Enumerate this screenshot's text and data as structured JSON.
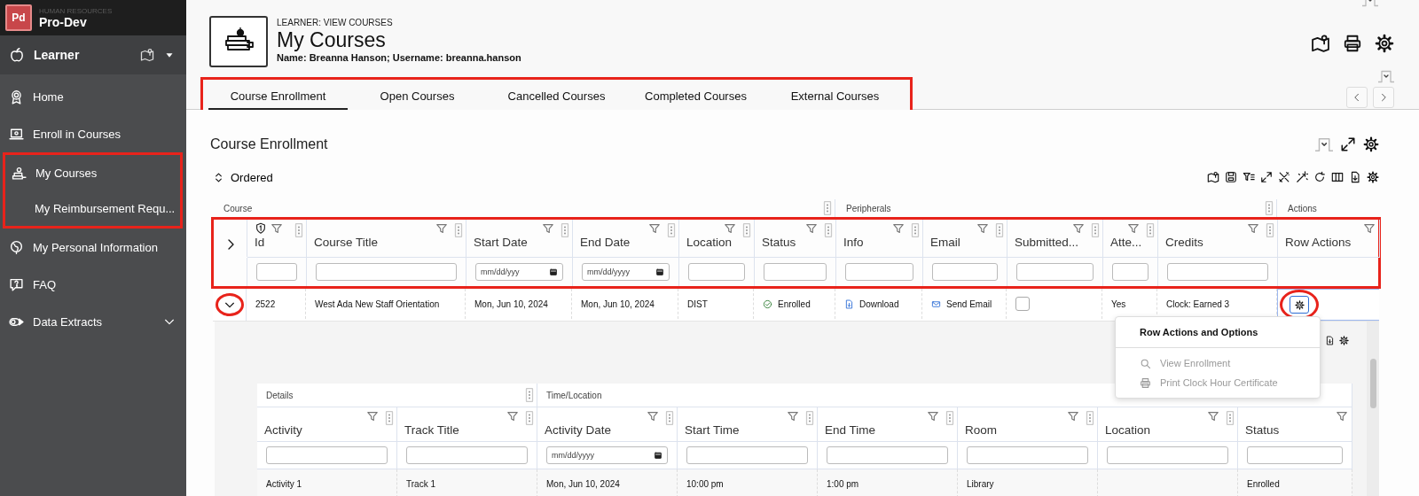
{
  "app": {
    "logo": "Pd",
    "org": "HUMAN RESOURCES",
    "name": "Pro-Dev"
  },
  "role": {
    "label": "Learner"
  },
  "nav": [
    {
      "label": "Home",
      "highlighted": false
    },
    {
      "label": "Enroll in Courses",
      "highlighted": false
    },
    {
      "label": "My Courses",
      "highlighted": true
    },
    {
      "label": "My Reimbursement Requ...",
      "highlighted": true
    },
    {
      "label": "My Personal Information",
      "highlighted": false
    },
    {
      "label": "FAQ",
      "highlighted": false
    },
    {
      "label": "Data Extracts",
      "highlighted": false,
      "expanded": false
    }
  ],
  "page": {
    "kicker": "LEARNER: VIEW COURSES",
    "title": "My Courses",
    "subtitle": "Name: Breanna Hanson; Username: breanna.hanson"
  },
  "tabs": {
    "highlighted": true,
    "items": [
      {
        "label": "Course Enrollment",
        "selected": true
      },
      {
        "label": "Open Courses",
        "selected": false
      },
      {
        "label": "Cancelled Courses",
        "selected": false
      },
      {
        "label": "Completed Courses",
        "selected": false
      },
      {
        "label": "External Courses",
        "selected": false
      }
    ]
  },
  "section": {
    "title": "Course Enrollment",
    "sort_label": "Ordered"
  },
  "table": {
    "expand_all": {
      "expanded": false
    },
    "header_highlighted": true,
    "groups": [
      {
        "label": "Course",
        "columns": [
          {
            "label": "Id",
            "kind": "text",
            "sorted": true
          },
          {
            "label": "Course Title",
            "kind": "text",
            "sorted": false
          },
          {
            "label": "Start Date",
            "kind": "date",
            "placeholder": "mm/dd/yyy",
            "sorted": false
          },
          {
            "label": "End Date",
            "kind": "date",
            "placeholder": "mm/dd/yyyy",
            "sorted": false
          },
          {
            "label": "Location",
            "kind": "text",
            "sorted": false
          },
          {
            "label": "Status",
            "kind": "text",
            "sorted": false
          }
        ]
      },
      {
        "label": "Peripherals",
        "columns": [
          {
            "label": "Info",
            "kind": "text",
            "sorted": false
          },
          {
            "label": "Email",
            "kind": "text",
            "sorted": false
          },
          {
            "label": "Submitted...",
            "kind": "text",
            "sorted": false
          },
          {
            "label": "Atte...",
            "kind": "text",
            "sorted": false
          },
          {
            "label": "Credits",
            "kind": "text",
            "sorted": false
          }
        ]
      },
      {
        "label": "Actions",
        "columns": [
          {
            "label": "Row Actions",
            "kind": "none",
            "sorted": false
          }
        ]
      }
    ],
    "rows": [
      {
        "expanded": true,
        "toggle_highlighted": true,
        "cells": [
          {
            "kind": "text",
            "value": "2522"
          },
          {
            "kind": "text",
            "value": "West Ada New Staff Orientation"
          },
          {
            "kind": "text",
            "value": "Mon, Jun 10, 2024"
          },
          {
            "kind": "text",
            "value": "Mon, Jun 10, 2024"
          },
          {
            "kind": "text",
            "value": "DIST"
          },
          {
            "kind": "status",
            "value": "Enrolled"
          },
          {
            "kind": "download",
            "value": "Download"
          },
          {
            "kind": "email",
            "value": "Send Email"
          },
          {
            "kind": "checkbox",
            "checked": false
          },
          {
            "kind": "text",
            "value": "Yes"
          },
          {
            "kind": "text",
            "value": "Clock: Earned 3"
          },
          {
            "kind": "actions",
            "highlighted": true
          }
        ]
      }
    ]
  },
  "menu": {
    "title": "Row Actions and Options",
    "items": [
      {
        "label": "View Enrollment",
        "disabled": true
      },
      {
        "label": "Print Clock Hour Certificate",
        "disabled": true
      }
    ]
  },
  "subtable": {
    "groups": [
      {
        "label": "Details",
        "columns": [
          {
            "label": "Activity",
            "kind": "text"
          },
          {
            "label": "Track Title",
            "kind": "text"
          }
        ]
      },
      {
        "label": "Time/Location",
        "columns": [
          {
            "label": "Activity Date",
            "kind": "date",
            "placeholder": "mm/dd/yyyy"
          },
          {
            "label": "Start Time",
            "kind": "text"
          },
          {
            "label": "End Time",
            "kind": "text"
          },
          {
            "label": "Room",
            "kind": "text"
          },
          {
            "label": "Location",
            "kind": "text"
          },
          {
            "label": "Status",
            "kind": "text"
          }
        ]
      }
    ],
    "rows": [
      {
        "cells": [
          "Activity 1",
          "Track 1",
          "Mon, Jun 10, 2024",
          "10:00 pm",
          "1:00 pm",
          "Library",
          "",
          "Enrolled"
        ]
      }
    ]
  }
}
